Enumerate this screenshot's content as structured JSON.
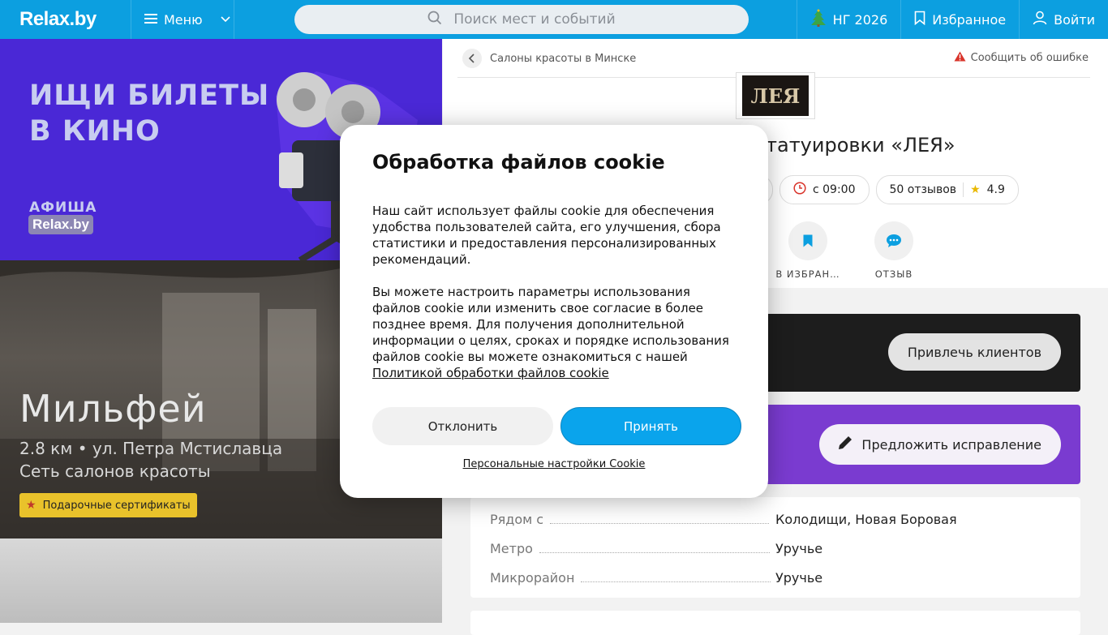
{
  "header": {
    "logo": "Relax.by",
    "menu_label": "Меню",
    "search_placeholder": "Поиск мест и событий",
    "ng_label": "НГ 2026",
    "favorites_label": "Избранное",
    "login_label": "Войти"
  },
  "banner": {
    "line1": "ИЩИ БИЛЕТЫ",
    "line2": "В КИНО",
    "brand_top": "АФИША",
    "brand_badge": "Relax.by"
  },
  "salon": {
    "title": "Мильфей",
    "address": "2.8 км • ул. Петра Мстиславца",
    "type": "Сеть салонов красоты",
    "gift_label": "Подарочные сертификаты"
  },
  "place": {
    "breadcrumb": "Салоны красоты в Минске",
    "report_label": "Сообщить об ошибке",
    "logo_text": "ЛЕЯ",
    "title_visible": "татуировки «ЛЕЯ»",
    "hours": "с 09:00",
    "reviews": "50 отзывов",
    "rating": "4.9",
    "actions": [
      {
        "label": "В ИЗБРАН…",
        "icon": "bookmark-icon"
      },
      {
        "label": "ОТЗЫВ",
        "icon": "chat-icon"
      }
    ],
    "attract_button": "Привлечь клиентов",
    "suggest_button": "Предложить исправление",
    "info": [
      {
        "label": "Рядом с",
        "value": "Колодищи, Новая Боровая"
      },
      {
        "label": "Метро",
        "value": "Уручье"
      },
      {
        "label": "Микрорайон",
        "value": "Уручье"
      }
    ]
  },
  "cookie": {
    "title": "Обработка файлов cookie",
    "paragraph1": "Наш сайт использует файлы cookie для обеспечения удобства пользователей сайта, его улучшения, сбора статистики и предоставления персонализированных рекомендаций.",
    "paragraph2": "Вы можете настроить параметры использования файлов cookie или изменить свое согласие в более позднее время. Для получения дополнительной информации о целях, сроках и порядке использования файлов cookie вы можете ознакомиться с нашей",
    "policy_link": "Политикой обработки файлов cookie",
    "decline_button": "Отклонить",
    "accept_button": "Принять",
    "personal_settings": "Персональные настройки Cookie"
  },
  "colors": {
    "brand": "#0c9fe0",
    "accept": "#0aa4ec",
    "banner_bg": "#4a28d6",
    "purple_card": "#7a3bd0",
    "gift_badge": "#e9c22b"
  }
}
